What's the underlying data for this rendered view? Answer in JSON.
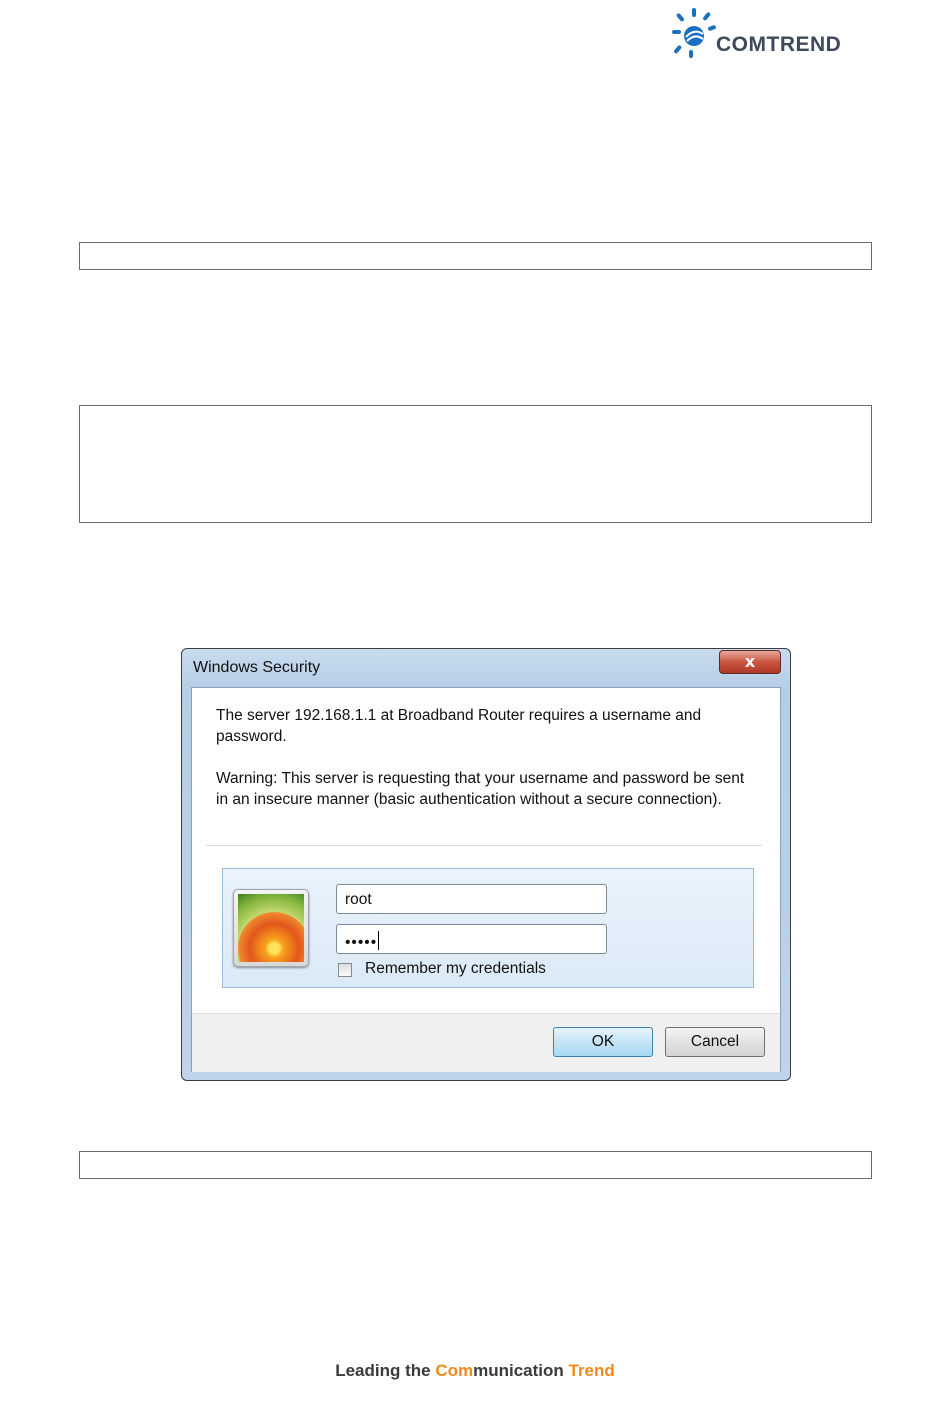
{
  "header": {
    "logo_text": "COMTREND"
  },
  "dialog": {
    "title": "Windows Security",
    "close_label": "x",
    "message": "The server 192.168.1.1 at Broadband Router requires a username and password.",
    "warning": "Warning: This server is requesting that your username and password be sent in an insecure manner (basic authentication without a secure connection).",
    "username_value": "root",
    "password_mask": "•••••",
    "remember_label": "Remember my credentials",
    "remember_checked": false,
    "ok_label": "OK",
    "cancel_label": "Cancel"
  },
  "footer": {
    "tagline_part1": "Leading the ",
    "tagline_highlight1": "Com",
    "tagline_part2": "munication ",
    "tagline_highlight2": "Trend"
  },
  "colors": {
    "accent_orange": "#f08a1c",
    "logo_blue": "#1b6fc0"
  }
}
